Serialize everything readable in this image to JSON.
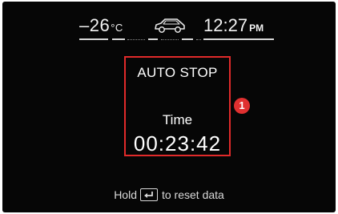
{
  "status": {
    "temperature": "–26",
    "temperature_unit": "°C",
    "vehicle_icon": "car-icon",
    "time": "12:27",
    "ampm": "PM"
  },
  "panel": {
    "title": "AUTO STOP",
    "label": "Time",
    "value": "00:23:42",
    "callout": "1",
    "highlight_color": "#e02a2a"
  },
  "footer": {
    "prefix": "Hold",
    "key_icon": "enter-key-icon",
    "suffix": "to reset data"
  }
}
